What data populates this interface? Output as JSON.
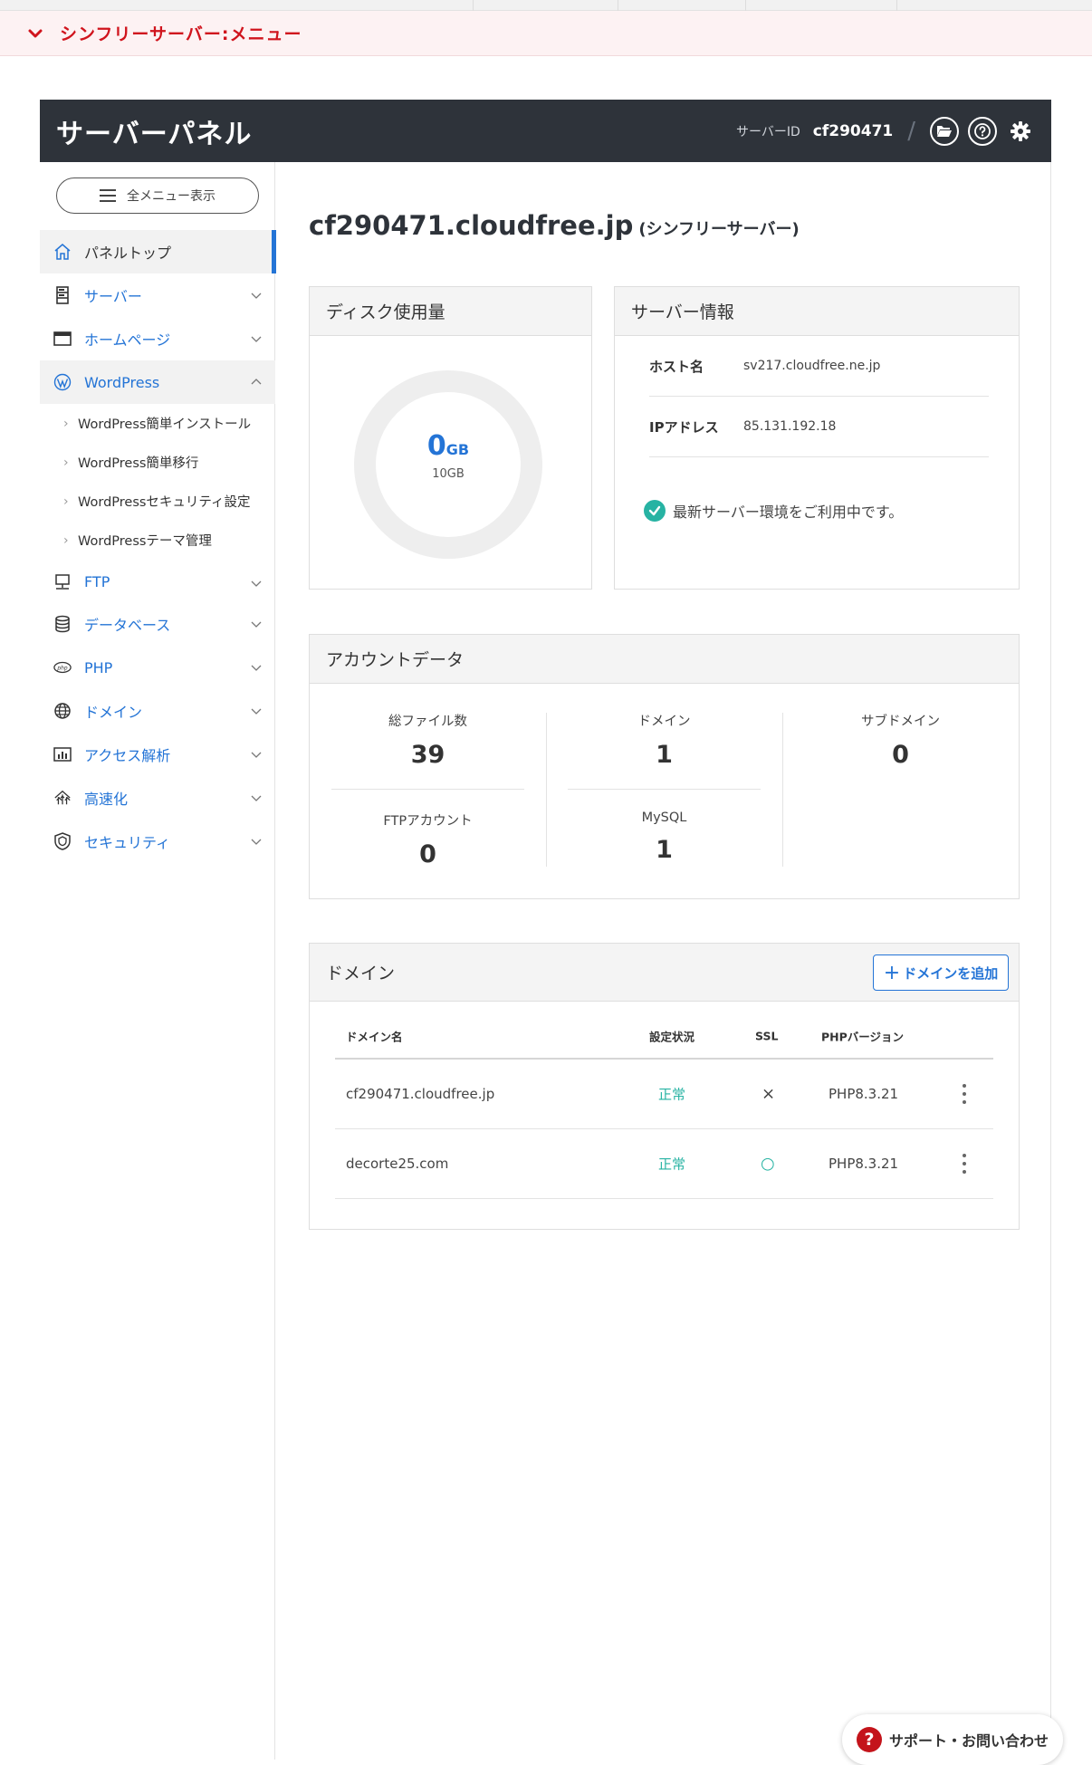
{
  "red_menu": {
    "label": "シンフリーサーバー:メニュー"
  },
  "header": {
    "title": "サーバーパネル",
    "server_id_label": "サーバーID",
    "server_id": "cf290471"
  },
  "sidebar": {
    "all_menu_label": "全メニュー表示",
    "items": [
      {
        "label": "パネルトップ",
        "icon": "home-icon"
      },
      {
        "label": "サーバー",
        "icon": "server-icon"
      },
      {
        "label": "ホームページ",
        "icon": "window-icon"
      },
      {
        "label": "WordPress",
        "icon": "wordpress-icon"
      },
      {
        "label": "FTP",
        "icon": "ftp-icon"
      },
      {
        "label": "データベース",
        "icon": "database-icon"
      },
      {
        "label": "PHP",
        "icon": "php-icon"
      },
      {
        "label": "ドメイン",
        "icon": "globe-icon"
      },
      {
        "label": "アクセス解析",
        "icon": "chart-icon"
      },
      {
        "label": "高速化",
        "icon": "speed-icon"
      },
      {
        "label": "セキュリティ",
        "icon": "shield-icon"
      }
    ],
    "wp_sub": [
      "WordPress簡単インストール",
      "WordPress簡単移行",
      "WordPressセキュリティ設定",
      "WordPressテーマ管理"
    ]
  },
  "main": {
    "domain": "cf290471.cloudfree.jp",
    "domain_sub": "(シンフリーサーバー)",
    "disk": {
      "title": "ディスク使用量",
      "used": "0",
      "used_unit": "GB",
      "total": "10GB",
      "used_fraction": 0
    },
    "server_info": {
      "title": "サーバー情報",
      "host_label": "ホスト名",
      "host": "sv217.cloudfree.ne.jp",
      "ip_label": "IPアドレス",
      "ip": "85.131.192.18",
      "status": "最新サーバー環境をご利用中です。"
    },
    "account": {
      "title": "アカウントデータ",
      "cells": [
        {
          "label": "総ファイル数",
          "value": "39"
        },
        {
          "label": "ドメイン",
          "value": "1"
        },
        {
          "label": "サブドメイン",
          "value": "0"
        },
        {
          "label": "FTPアカウント",
          "value": "0"
        },
        {
          "label": "MySQL",
          "value": "1"
        }
      ]
    },
    "domains": {
      "title": "ドメイン",
      "add_label": "ドメインを追加",
      "columns": [
        "ドメイン名",
        "設定状況",
        "SSL",
        "PHPバージョン"
      ],
      "rows": [
        {
          "name": "cf290471.cloudfree.jp",
          "status": "正常",
          "ssl": "×",
          "php": "PHP8.3.21"
        },
        {
          "name": "decorte25.com",
          "status": "正常",
          "ssl": "○",
          "php": "PHP8.3.21"
        }
      ]
    }
  },
  "support": {
    "label": "サポート・お問い合わせ"
  },
  "colors": {
    "accent": "#2474d6",
    "header_bg": "#2e333a",
    "menu_red": "#d0141d",
    "ok_teal": "#27b3a3"
  }
}
